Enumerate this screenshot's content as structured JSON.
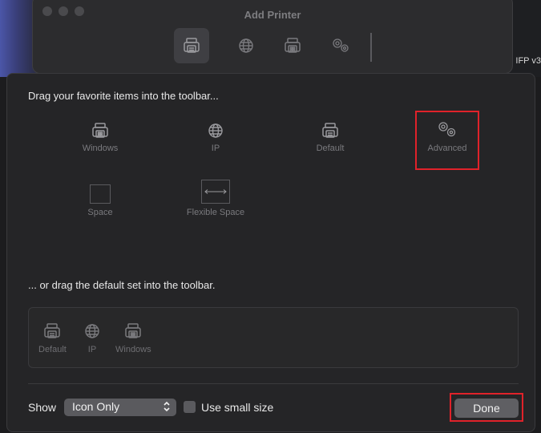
{
  "window": {
    "title": "Add Printer",
    "desktop_label": "IFP v3"
  },
  "sheet": {
    "heading": "Drag your favorite items into the toolbar...",
    "items": [
      {
        "label": "Windows",
        "icon": "printer-icon"
      },
      {
        "label": "IP",
        "icon": "globe-icon"
      },
      {
        "label": "Default",
        "icon": "printer-icon"
      },
      {
        "label": "Advanced",
        "icon": "gears-icon"
      },
      {
        "label": "Space",
        "icon": "space-box-icon"
      },
      {
        "label": "Flexible Space",
        "icon": "flexible-space-icon"
      }
    ],
    "default_heading": "... or drag the default set into the toolbar.",
    "default_set": [
      {
        "label": "Default",
        "icon": "printer-icon"
      },
      {
        "label": "IP",
        "icon": "globe-icon"
      },
      {
        "label": "Windows",
        "icon": "printer-icon"
      }
    ],
    "footer": {
      "show_label": "Show",
      "show_value": "Icon Only",
      "small_size_label": "Use small size",
      "small_size_checked": false,
      "done_label": "Done"
    }
  },
  "colors": {
    "highlight": "#e0222a",
    "sheet_bg": "#252527"
  }
}
